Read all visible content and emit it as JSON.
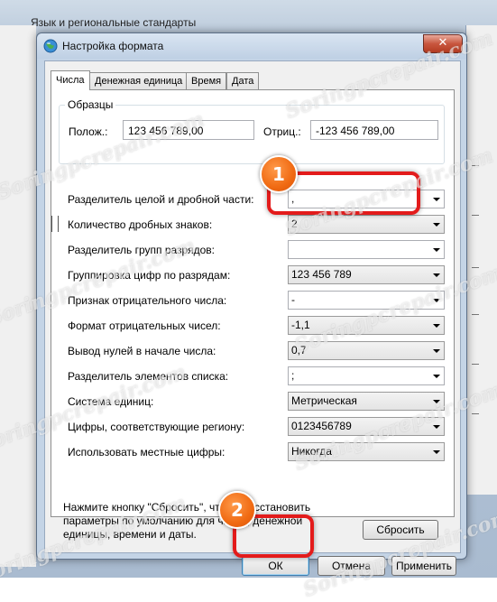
{
  "background": {
    "window_title": "Язык и региональные стандарты"
  },
  "dialog": {
    "title": "Настройка формата",
    "close_label": "✕"
  },
  "tabs": [
    {
      "label": "Числа",
      "active": true
    },
    {
      "label": "Денежная единица",
      "active": false
    },
    {
      "label": "Время",
      "active": false
    },
    {
      "label": "Дата",
      "active": false
    }
  ],
  "samples": {
    "group_label": "Образцы",
    "positive_label": "Полож.:",
    "positive_value": "123 456 789,00",
    "negative_label": "Отриц.:",
    "negative_value": "-123 456 789,00"
  },
  "settings": [
    {
      "label": "Разделитель целой и дробной части:",
      "value": ","
    },
    {
      "label": "Количество дробных знаков:",
      "value": "2"
    },
    {
      "label": "Разделитель групп разрядов:",
      "value": ""
    },
    {
      "label": "Группировка цифр по разрядам:",
      "value": "123 456 789"
    },
    {
      "label": "Признак отрицательного числа:",
      "value": "-"
    },
    {
      "label": "Формат отрицательных чисел:",
      "value": "-1,1"
    },
    {
      "label": "Вывод нулей в начале числа:",
      "value": "0,7"
    },
    {
      "label": "Разделитель элементов списка:",
      "value": ";"
    },
    {
      "label": "Система единиц:",
      "value": "Метрическая"
    },
    {
      "label": "Цифры, соответствующие региону:",
      "value": "0123456789"
    },
    {
      "label": "Использовать местные цифры:",
      "value": "Никогда"
    }
  ],
  "note": "Нажмите кнопку \"Сбросить\", чтобы восстановить параметры по умолчанию для чисел, денежной единицы, времени и даты.",
  "buttons": {
    "reset": "Сбросить",
    "ok": "ОК",
    "cancel": "Отмена",
    "apply": "Применить"
  },
  "callouts": {
    "badge1": "1",
    "badge2": "2"
  },
  "watermark": "Soringpcrepair.com",
  "colors": {
    "callout_red": "#e31b1b",
    "badge_orange": "#f06a12",
    "titlebar": "#c4d4e6"
  }
}
